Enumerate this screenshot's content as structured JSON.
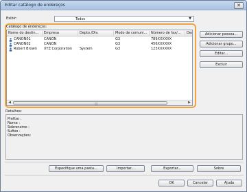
{
  "window": {
    "title": "Editar catálogo de endereços",
    "close_glyph": "✕"
  },
  "filter": {
    "label": "Exibir:",
    "selected": "Todos"
  },
  "list": {
    "label": "Catálogo de endereços:",
    "columns": [
      "Nome do destin...",
      "Empresa",
      "Depto./Div.",
      "Modo de comuni...",
      "Número de fax/...",
      "Des"
    ],
    "rows": [
      {
        "name": "CANON01",
        "company": "CANON",
        "dept": "",
        "mode": "G3",
        "fax": "789XXXXXX"
      },
      {
        "name": "CANON02",
        "company": "CANON",
        "dept": "",
        "mode": "G3",
        "fax": "456XXXXXX"
      },
      {
        "name": "Robert Brown",
        "company": "XYZ Corporation",
        "dept": "System",
        "mode": "G3",
        "fax": "123XXXXXX"
      }
    ],
    "row_icon": "person-icon"
  },
  "side_buttons": {
    "add_person": "Adicionar pessoa...",
    "add_group": "Adicionar grupo...",
    "edit": "Editar...",
    "delete": "Excluir"
  },
  "details": {
    "label": "Detalhes:",
    "fields": [
      "Prefixo :",
      "Nome :",
      "Sobrenome :",
      "Sufixo :",
      "Observações:"
    ]
  },
  "bottom_buttons": {
    "specify": "Especifique uma pasta...",
    "import": "Importar...",
    "export": "Exportar...",
    "about": "Sobre"
  },
  "dialog_buttons": {
    "ok": "OK",
    "cancel": "Cancelar",
    "help": "Ajuda"
  },
  "colors": {
    "highlight": "#f0a33a",
    "titlebar": "#b7cde9"
  }
}
